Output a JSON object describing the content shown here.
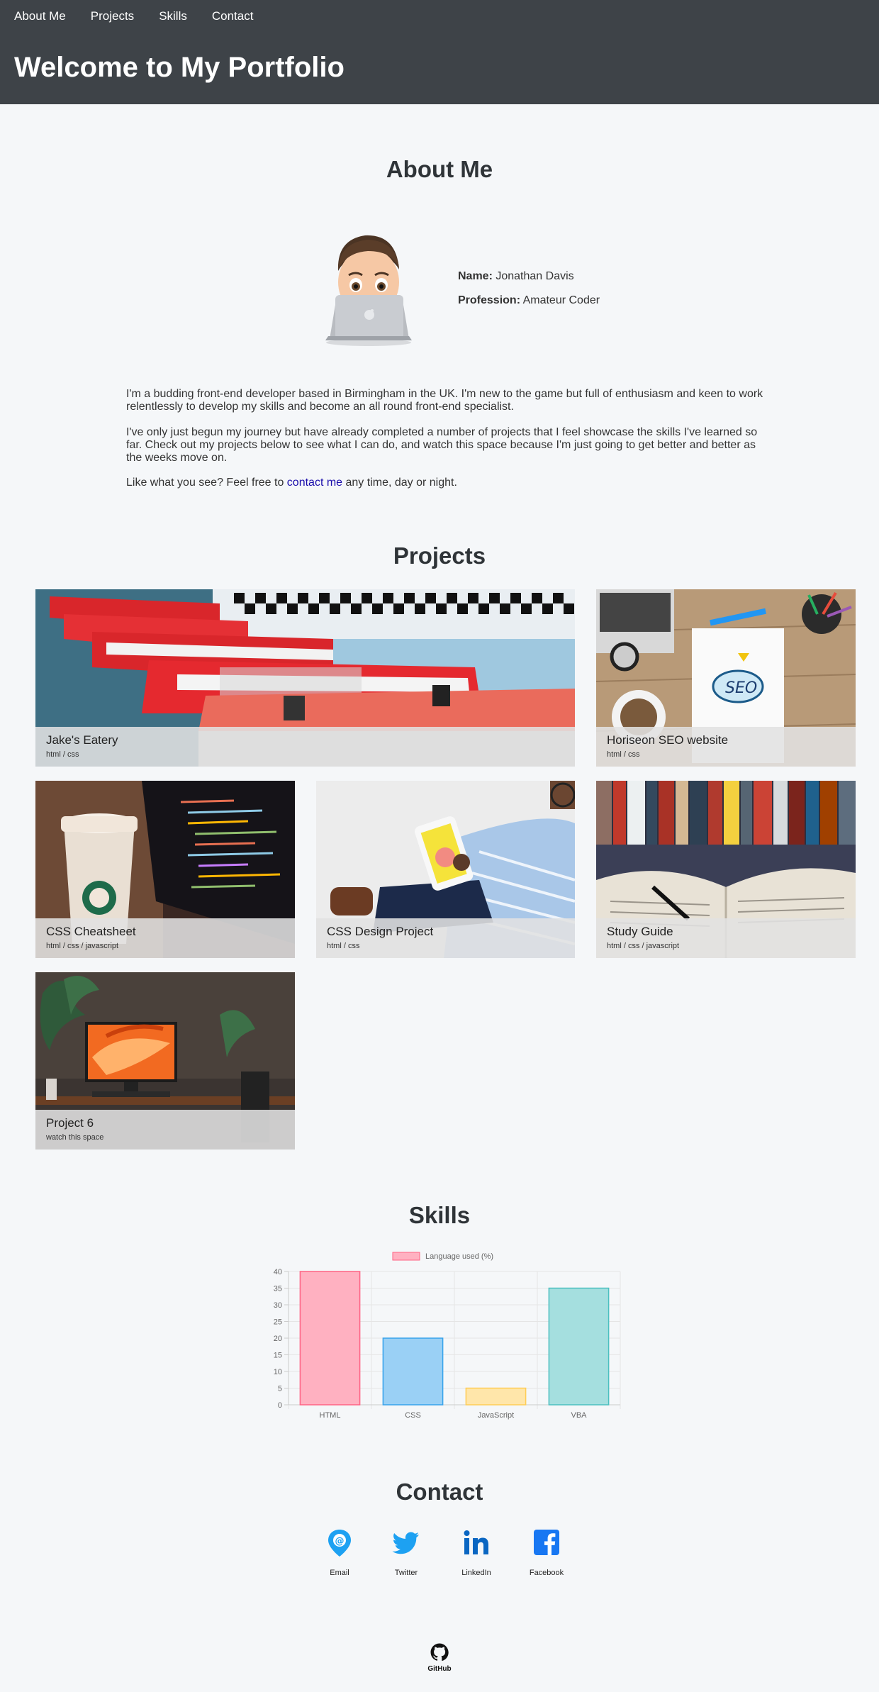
{
  "nav": {
    "items": [
      "About Me",
      "Projects",
      "Skills",
      "Contact"
    ]
  },
  "header": {
    "title": "Welcome to My Portfolio"
  },
  "about": {
    "heading": "About Me",
    "name_label": "Name:",
    "name_value": "Jonathan Davis",
    "profession_label": "Profession:",
    "profession_value": "Amateur Coder",
    "paragraphs": [
      "I'm a budding front-end developer based in Birmingham in the UK. I'm new to the game but full of enthusiasm and keen to work relentlessly to develop my skills and become an all round front-end specialist.",
      "I've only just begun my journey but have already completed a number of projects that I feel showcase the skills I've learned so far. Check out my projects below to see what I can do, and watch this space because I'm just going to get better and better as the weeks move on."
    ],
    "closing_prefix": "Like what you see? Feel free to ",
    "closing_link": "contact me",
    "closing_suffix": " any time, day or night."
  },
  "projects": {
    "heading": "Projects",
    "items": [
      {
        "title": "Jake's Eatery",
        "tech": "html / css"
      },
      {
        "title": "Horiseon SEO website",
        "tech": "html / css"
      },
      {
        "title": "CSS Cheatsheet",
        "tech": "html / css / javascript"
      },
      {
        "title": "CSS Design Project",
        "tech": "html / css"
      },
      {
        "title": "Study Guide",
        "tech": "html / css / javascript"
      },
      {
        "title": "Project 6",
        "tech": "watch this space"
      }
    ]
  },
  "skills": {
    "heading": "Skills"
  },
  "chart_data": {
    "type": "bar",
    "categories": [
      "HTML",
      "CSS",
      "JavaScript",
      "VBA"
    ],
    "series": [
      {
        "name": "Language used (%)",
        "values": [
          40,
          20,
          5,
          35
        ]
      }
    ],
    "ylim": [
      0,
      40
    ],
    "yticks": [
      0,
      5,
      10,
      15,
      20,
      25,
      30,
      35,
      40
    ],
    "legend": "top",
    "grid": true,
    "colors": {
      "fills": [
        "#ffb1c1",
        "#9ad0f5",
        "#ffe6aa",
        "#a5dfdf"
      ],
      "borders": [
        "#ff6384",
        "#36a2eb",
        "#ffcd56",
        "#4bc0c0"
      ]
    }
  },
  "contact": {
    "heading": "Contact",
    "items": [
      {
        "label": "Email",
        "icon": "email-pin-icon",
        "color": "#1da1f2"
      },
      {
        "label": "Twitter",
        "icon": "twitter-icon",
        "color": "#1da1f2"
      },
      {
        "label": "LinkedIn",
        "icon": "linkedin-icon",
        "color": "#0a66c2"
      },
      {
        "label": "Facebook",
        "icon": "facebook-icon",
        "color": "#1877f2"
      }
    ]
  },
  "footer": {
    "github_label": "GitHub"
  }
}
